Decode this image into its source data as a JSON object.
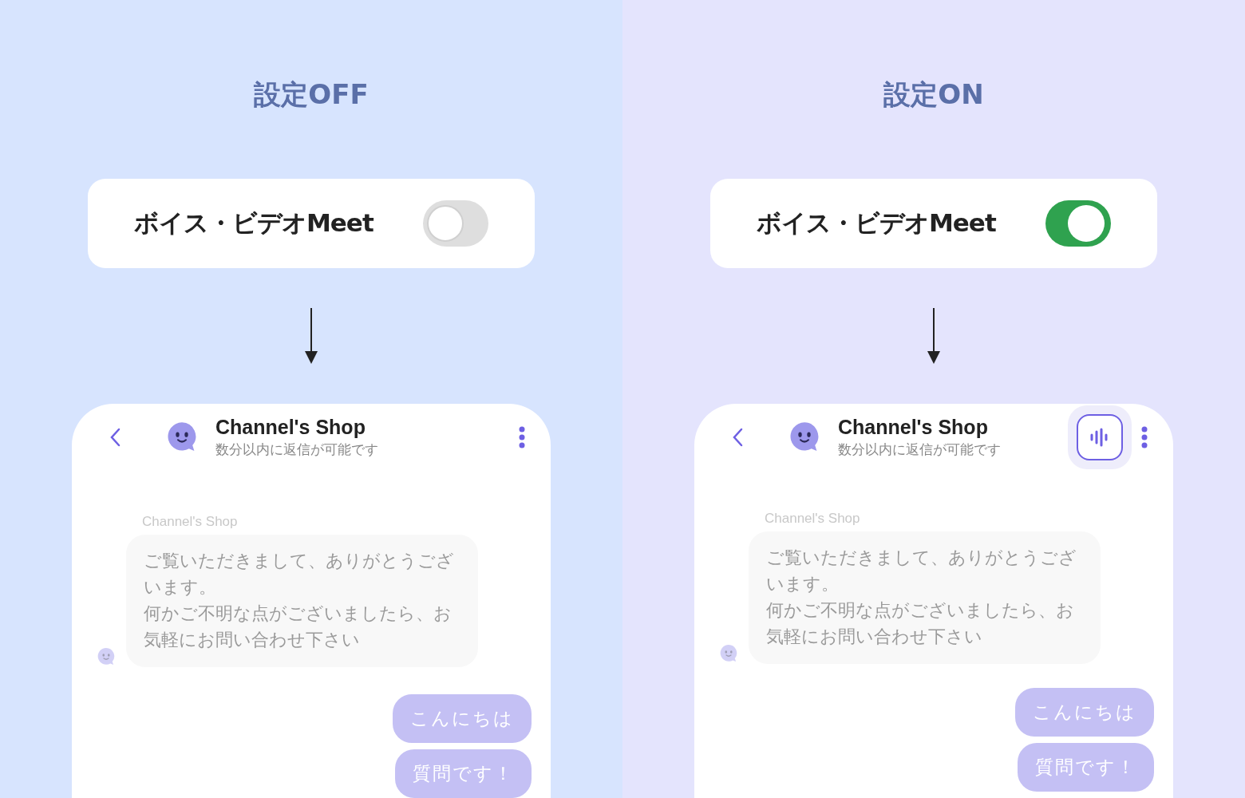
{
  "panels": [
    {
      "title": "設定OFF",
      "toggle": {
        "label": "ボイス・ビデオMeet",
        "on": false
      },
      "chat": {
        "name": "Channel's Shop",
        "status": "数分以内に返信が可能です",
        "messages": [
          {
            "kind": "bot",
            "sender": "Channel's Shop",
            "lines": [
              "ご覧いただきまして、ありがとうございます。",
              "何かご不明な点がございましたら、お気軽にお問い合わせ下さい"
            ]
          },
          {
            "kind": "user",
            "text": "こんにちは"
          },
          {
            "kind": "user",
            "text": "質問です！"
          }
        ]
      }
    },
    {
      "title": "設定ON",
      "toggle": {
        "label": "ボイス・ビデオMeet",
        "on": true
      },
      "chat": {
        "name": "Channel's Shop",
        "status": "数分以内に返信が可能です",
        "messages": [
          {
            "kind": "bot",
            "sender": "Channel's Shop",
            "lines": [
              "ご覧いただきまして、ありがとうございます。",
              "何かご不明な点がございましたら、お気軽にお問い合わせ下さい"
            ]
          },
          {
            "kind": "user",
            "text": "こんにちは"
          },
          {
            "kind": "user",
            "text": "質問です！"
          }
        ]
      }
    }
  ]
}
